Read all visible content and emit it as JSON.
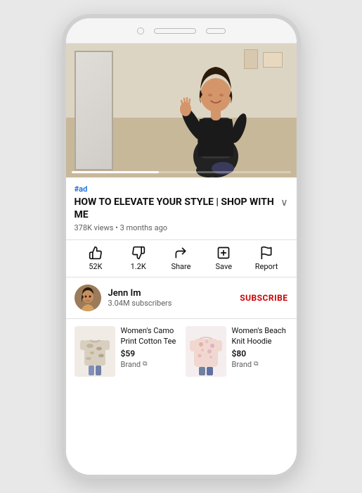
{
  "phone": {
    "ad_label": "#ad",
    "video_title": "HOW TO ELEVATE YOUR STYLE | SHOP WITH ME",
    "video_meta": "378K views • 3 months ago",
    "actions": [
      {
        "id": "like",
        "icon": "👍",
        "label": "52K"
      },
      {
        "id": "dislike",
        "icon": "👎",
        "label": "1.2K"
      },
      {
        "id": "share",
        "icon": "↪",
        "label": "Share"
      },
      {
        "id": "save",
        "icon": "⊞",
        "label": "Save"
      },
      {
        "id": "report",
        "icon": "⚑",
        "label": "Report"
      }
    ],
    "channel": {
      "name": "Jenn Im",
      "subscribers": "3.04M subscribers",
      "subscribe_label": "SUBSCRIBE"
    },
    "products": [
      {
        "name": "Women's Camo Print Cotton Tee",
        "price": "$59",
        "brand": "Brand"
      },
      {
        "name": "Women's Beach Knit Hoodie",
        "price": "$80",
        "brand": "Brand"
      }
    ]
  }
}
